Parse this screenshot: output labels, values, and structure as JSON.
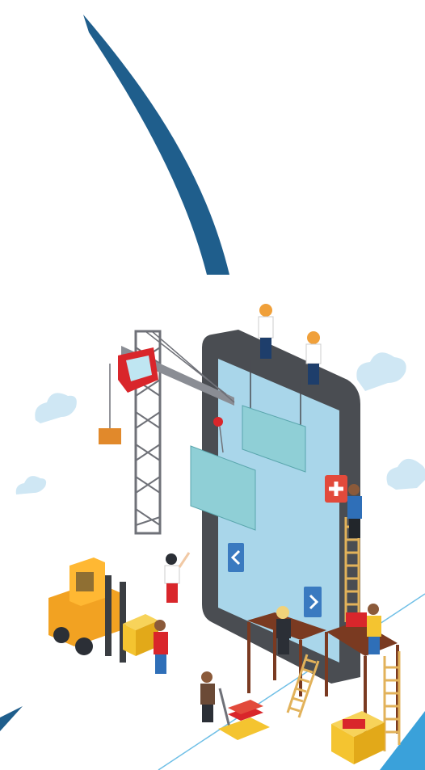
{
  "illustration": {
    "subject": "isometric-app-construction",
    "elements": [
      "blue-arc-stroke",
      "smartphone-frame",
      "tower-crane",
      "hanging-panels",
      "forklift",
      "workers",
      "ladders",
      "scaffold-platforms",
      "clouds",
      "nav-arrow-icons",
      "medical-cross-icon",
      "pallet-jack",
      "boxes"
    ],
    "colors": {
      "arc": "#1f5e8c",
      "phone_frame": "#4a4d52",
      "phone_screen": "#a9d6ea",
      "panel": "#8fcfd6",
      "crane": "#6f7178",
      "crane_cab": "#d9262b",
      "forklift": "#f2a222",
      "scaffold": "#7a3a21",
      "ladder": "#e2b25a",
      "cloud": "#cfe7f4",
      "accent_blue": "#3aa1da",
      "box": "#f4c430"
    }
  }
}
